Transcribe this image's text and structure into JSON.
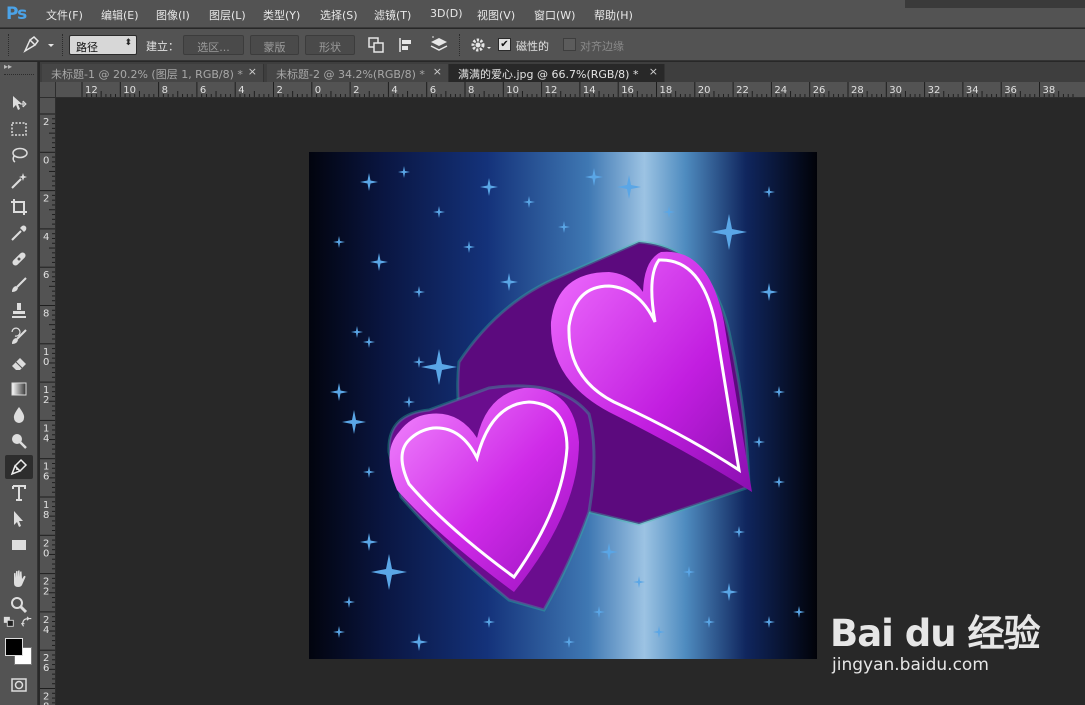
{
  "app": {
    "logo": "Ps"
  },
  "menu": [
    "文件(F)",
    "编辑(E)",
    "图像(I)",
    "图层(L)",
    "类型(Y)",
    "选择(S)",
    "滤镜(T)",
    "3D(D)",
    "视图(V)",
    "窗口(W)",
    "帮助(H)"
  ],
  "options": {
    "mode_value": "路径",
    "make_label": "建立：",
    "selection_button": "选区...",
    "mask_button": "蒙版",
    "shape_button": "形状",
    "magnetic_label": "磁性的",
    "magnetic_checked": true,
    "align_edges_label": "对齐边缘",
    "align_edges_checked": false
  },
  "tabs": [
    {
      "label": "未标题-1 @ 20.2% (图层 1, RGB/8) *",
      "close": "×",
      "active": false
    },
    {
      "label": "未标题-2 @ 34.2%(RGB/8) *",
      "close": "×",
      "active": false
    },
    {
      "label": "满满的爱心.jpg @ 66.7%(RGB/8) *",
      "close": "×",
      "active": true
    }
  ],
  "ruler_h_labels": [
    "12",
    "10",
    "8",
    "6",
    "4",
    "2",
    "0",
    "2",
    "4",
    "6",
    "8",
    "10",
    "12",
    "14",
    "16",
    "18",
    "20",
    "22",
    "24",
    "26",
    "28",
    "30",
    "32",
    "34",
    "36",
    "38"
  ],
  "ruler_v_labels": [
    "2",
    "0",
    "2",
    "4",
    "6",
    "8",
    "10",
    "12",
    "14",
    "16",
    "18",
    "20",
    "22",
    "24",
    "26",
    "28"
  ],
  "tools": [
    "move-tool",
    "marquee-tool",
    "lasso-tool",
    "magic-wand-tool",
    "crop-tool",
    "eyedropper-tool",
    "healing-brush-tool",
    "brush-tool",
    "clone-stamp-tool",
    "history-brush-tool",
    "eraser-tool",
    "gradient-tool",
    "blur-tool",
    "dodge-tool",
    "pen-tool",
    "type-tool",
    "path-selection-tool",
    "rectangle-tool",
    "hand-tool",
    "zoom-tool"
  ],
  "selected_tool": "pen-tool",
  "colors": {
    "foreground": "#000000",
    "background": "#ffffff",
    "accent": "#4ba3e8"
  },
  "watermark": {
    "brand": "Bai du 经验",
    "url": "jingyan.baidu.com"
  }
}
